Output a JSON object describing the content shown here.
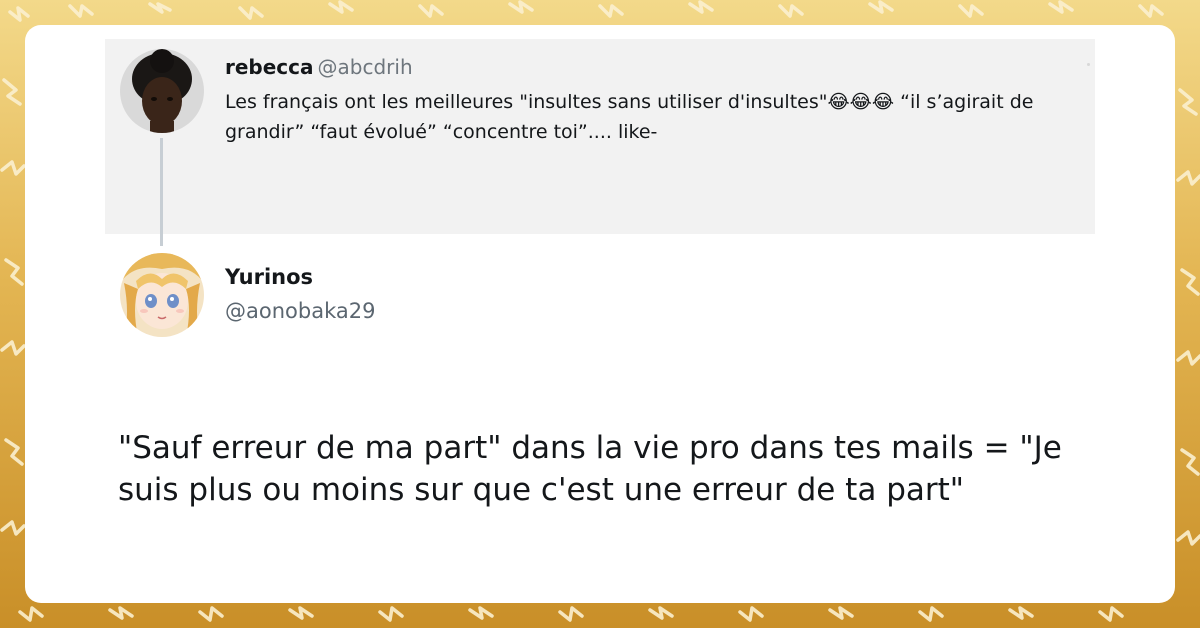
{
  "colors": {
    "background_top": "#f3d98a",
    "background_bottom": "#c98f28",
    "card": "#ffffff",
    "quoted_bg": "#f2f2f2",
    "handle": "#6e767d",
    "thread_line": "#c7ced4"
  },
  "quoted_tweet": {
    "name": "rebecca",
    "handle": "@abcdrih",
    "text": "Les français ont les meilleures \"insultes sans utiliser d'insultes\"😂😂😂 “il s’agirait de grandir” “faut évolué” “concentre toi”.... like-",
    "avatar_icon": "profile-photo"
  },
  "reply_tweet": {
    "name": "Yurinos",
    "handle": "@aonobaka29",
    "text": "\"Sauf erreur de ma part\" dans la vie pro dans tes mails = \"Je suis plus ou moins sur que c'est une erreur de ta part\"",
    "avatar_icon": "anime-character-avatar"
  }
}
